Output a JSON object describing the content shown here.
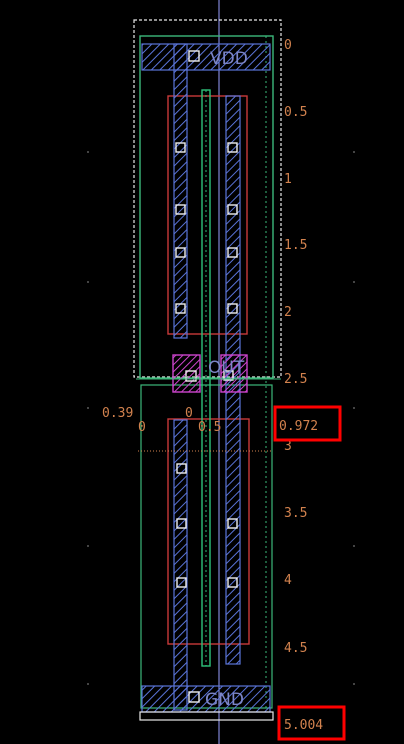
{
  "layout_view": {
    "colors": {
      "background": "#000000",
      "ruler_text": "#d2824e",
      "highlight_box": "#ff0000",
      "boundary": "#e8e8e8",
      "nwell": "#3cb87a",
      "diffusion": "#c83a3a",
      "poly": "#2ec27a",
      "metal": "#5a74d8",
      "contact": "#f0f0f0",
      "via": "#cc44cc",
      "crosshair": "#9aa0ff"
    },
    "ruler_labels": [
      "0",
      "0.5",
      "1",
      "1.5",
      "2",
      "2.5",
      "3",
      "3.5",
      "4",
      "4.5"
    ],
    "dims": {
      "left_0_39": "0.39",
      "left_0": "0",
      "mid_0": "0",
      "mid_0_5": "0.5",
      "highlight_0_972": "0.972",
      "highlight_5_004": "5.004"
    },
    "pins": {
      "top": "VDD",
      "middle": "OUT",
      "bottom": "GND"
    }
  }
}
